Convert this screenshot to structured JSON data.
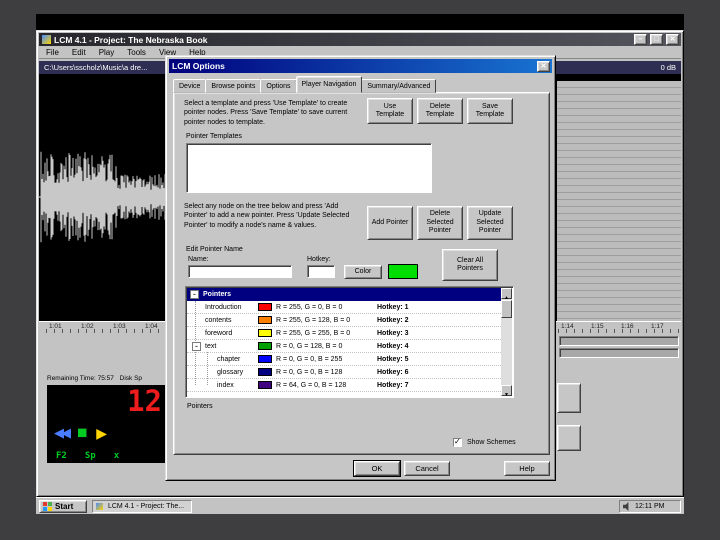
{
  "window": {
    "title": "LCM 4.1 - Project: The Nebraska Book",
    "controls": {
      "min": "–",
      "max": "□",
      "close": "✕"
    },
    "menu": [
      "File",
      "Edit",
      "Play",
      "Tools",
      "View",
      "Help"
    ],
    "pathbar": {
      "path": "C:\\Users\\sscholz\\Music\\a dre...",
      "level": "0 dB"
    },
    "ruler": {
      "left_ticks": [
        "1:01",
        "1:02",
        "1:03",
        "1:04"
      ],
      "right_ticks": [
        "1:14",
        "1:15",
        "1:16",
        "1:17"
      ]
    }
  },
  "transport": {
    "remaining": "Remaining Time: 75:57",
    "disk": "Disk Sp",
    "lcd": "12",
    "buttons": [
      {
        "name": "rewind",
        "glyph": "◀◀",
        "color": "#4a7dff"
      },
      {
        "name": "stop",
        "glyph": "■",
        "color": "#00cc22"
      },
      {
        "name": "play",
        "glyph": "▶",
        "color": "#ffd400"
      }
    ],
    "keys": [
      "F2",
      "Sp",
      "x"
    ]
  },
  "dialog": {
    "title": "LCM Options",
    "close": "✕",
    "tabs": [
      "Device",
      "Browse points",
      "Options",
      "Player Navigation",
      "Summary/Advanced"
    ],
    "instr_templates": "Select a template and press 'Use Template' to create pointer nodes. Press 'Save Template' to save current pointer nodes to template.",
    "template_buttons": [
      "Use Template",
      "Delete Template",
      "Save Template"
    ],
    "templates_label": "Pointer Templates",
    "instr_pointers": "Select any node on the tree below and press 'Add Pointer' to add a new pointer. Press 'Update Selected Pointer' to modify a node's name & values.",
    "pointer_buttons": [
      "Add Pointer",
      "Delete Selected Pointer",
      "Update Selected Pointer"
    ],
    "edit": {
      "group_label": "Edit Pointer Name",
      "name_label": "Name:",
      "hotkey_label": "Hotkey:",
      "name_value": "",
      "hotkey_value": "",
      "color_button": "Color",
      "swatch_color": "#00dd00",
      "clear_button": "Clear All Pointers"
    },
    "tree": {
      "root": "Pointers",
      "rows": [
        {
          "name": "Introduction",
          "color": "#ff0000",
          "rgb": "R = 255, G = 0, B = 0",
          "hotkey": "Hotkey: 1"
        },
        {
          "name": "contents",
          "color": "#ff8000",
          "rgb": "R = 255, G = 128, B = 0",
          "hotkey": "Hotkey: 2"
        },
        {
          "name": "foreword",
          "color": "#ffff00",
          "rgb": "R = 255, G = 255, B = 0",
          "hotkey": "Hotkey: 3"
        },
        {
          "name": "text",
          "color": "#00a000",
          "rgb": "R = 0, G = 128, B = 0",
          "hotkey": "Hotkey: 4"
        },
        {
          "name": "chapter",
          "color": "#0000ff",
          "rgb": "R = 0, G = 0, B = 255",
          "hotkey": "Hotkey: 5"
        },
        {
          "name": "glossary",
          "color": "#000080",
          "rgb": "R = 0, G = 0, B = 128",
          "hotkey": "Hotkey: 6"
        },
        {
          "name": "index",
          "color": "#400080",
          "rgb": "R = 64, G = 0, B = 128",
          "hotkey": "Hotkey: 7"
        }
      ]
    },
    "pointers_label": "Pointers",
    "show_checkbox": "Show Schemes",
    "ok": "OK",
    "cancel": "Cancel",
    "help": "Help"
  },
  "taskbar": {
    "start": "Start",
    "task": "LCM 4.1 - Project: The...",
    "tray_time": "12:11 PM"
  }
}
